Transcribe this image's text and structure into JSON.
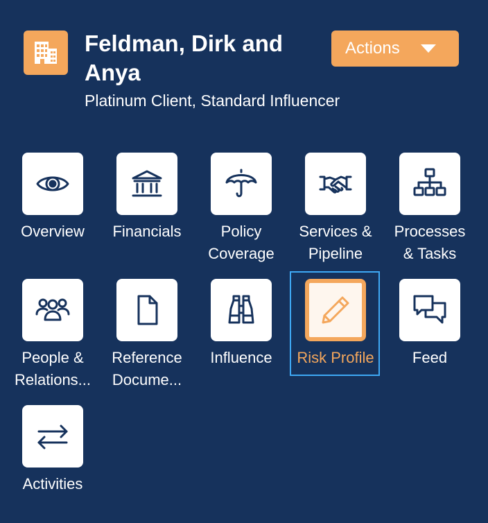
{
  "header": {
    "icon": "building-icon",
    "title": "Feldman, Dirk and Anya",
    "subtitle": "Platinum Client, Standard Influencer",
    "actions_label": "Actions"
  },
  "colors": {
    "background": "#16325c",
    "accent": "#f4a75c",
    "tile": "#ffffff",
    "icon_stroke": "#16325c",
    "focus_outline": "#3fa9f5"
  },
  "tiles": [
    {
      "label": "Overview",
      "icon": "eye-icon",
      "selected": false
    },
    {
      "label": "Financials",
      "icon": "bank-icon",
      "selected": false
    },
    {
      "label": "Policy\nCoverage",
      "icon": "umbrella-icon",
      "selected": false
    },
    {
      "label": "Services &\nPipeline",
      "icon": "handshake-icon",
      "selected": false
    },
    {
      "label": "Processes\n& Tasks",
      "icon": "hierarchy-icon",
      "selected": false
    },
    {
      "label": "People &\nRelations...",
      "icon": "people-icon",
      "selected": false
    },
    {
      "label": "Reference\nDocume...",
      "icon": "document-icon",
      "selected": false
    },
    {
      "label": "Influence",
      "icon": "binoculars-icon",
      "selected": false
    },
    {
      "label": "Risk Profile",
      "icon": "pencil-icon",
      "selected": true
    },
    {
      "label": "Feed",
      "icon": "chat-bubbles-icon",
      "selected": false
    },
    {
      "label": "Activities",
      "icon": "swap-arrows-icon",
      "selected": false
    }
  ]
}
